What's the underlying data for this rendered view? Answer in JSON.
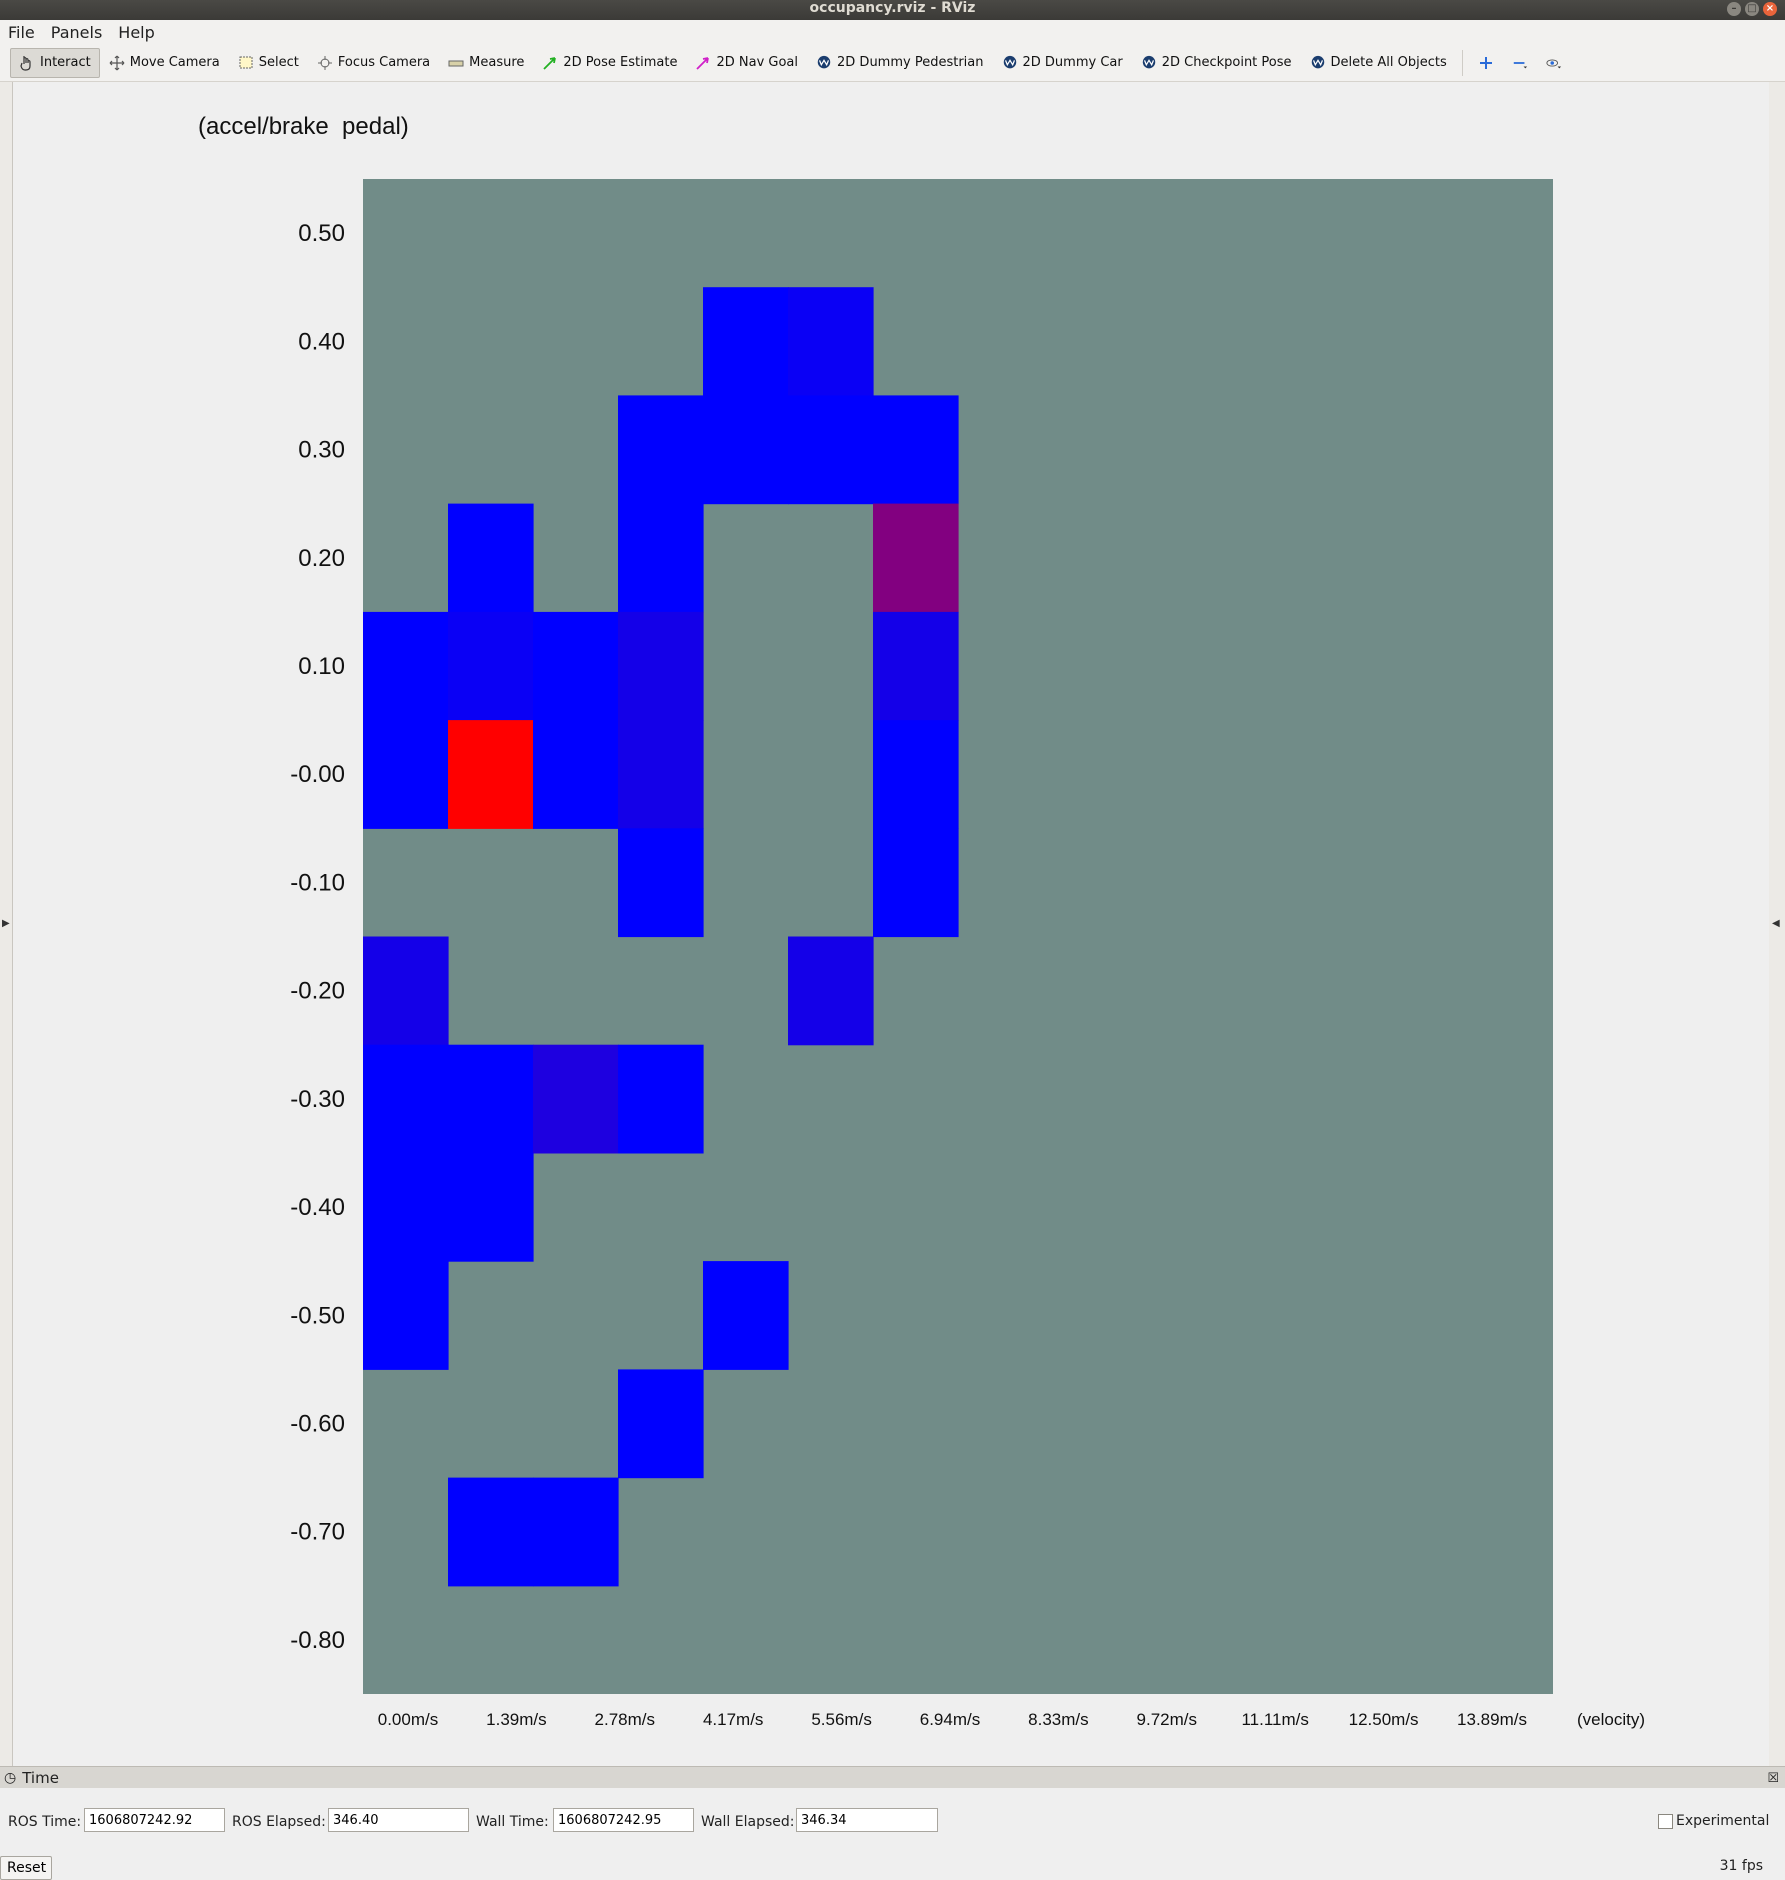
{
  "window": {
    "title": "occupancy.rviz - RViz"
  },
  "menu": {
    "items": [
      "File",
      "Panels",
      "Help"
    ]
  },
  "toolbar": {
    "tools": [
      {
        "label": "Interact",
        "icon": "hand-pointer-icon",
        "active": true
      },
      {
        "label": "Move Camera",
        "icon": "move-camera-icon",
        "active": false
      },
      {
        "label": "Select",
        "icon": "select-box-icon",
        "active": false
      },
      {
        "label": "Focus Camera",
        "icon": "focus-crosshair-icon",
        "active": false
      },
      {
        "label": "Measure",
        "icon": "ruler-icon",
        "active": false
      },
      {
        "label": "2D Pose Estimate",
        "icon": "green-arrow-icon",
        "active": false
      },
      {
        "label": "2D Nav Goal",
        "icon": "magenta-arrow-icon",
        "active": false
      },
      {
        "label": "2D Dummy Pedestrian",
        "icon": "autoware-logo-icon",
        "active": false
      },
      {
        "label": "2D Dummy Car",
        "icon": "autoware-logo-icon",
        "active": false
      },
      {
        "label": "2D Checkpoint Pose",
        "icon": "autoware-logo-icon",
        "active": false
      },
      {
        "label": "Delete All Objects",
        "icon": "autoware-logo-icon",
        "active": false
      }
    ],
    "extra_icons": [
      "add-tool-icon",
      "remove-tool-icon",
      "view-eye-icon"
    ]
  },
  "chart_data": {
    "type": "heatmap",
    "title": "",
    "ylabel": "(accel/brake  pedal)",
    "xlabel": "(velocity)",
    "x_ticks": [
      "0.00m/s",
      "1.39m/s",
      "2.78m/s",
      "4.17m/s",
      "5.56m/s",
      "6.94m/s",
      "8.33m/s",
      "9.72m/s",
      "11.11m/s",
      "12.50m/s",
      "13.89m/s"
    ],
    "y_ticks": [
      "0.50",
      "0.40",
      "0.30",
      "0.20",
      "0.10",
      "-0.00",
      "-0.10",
      "-0.20",
      "-0.30",
      "-0.40",
      "-0.50",
      "-0.60",
      "-0.70",
      "-0.80"
    ],
    "colors": {
      "background": "#718c88",
      "blue": "#0000ff",
      "blue_2": "#0a00f5",
      "blue_3": "#1400e8",
      "blue_4": "#1e00e0",
      "purple": "#820080",
      "red": "#ff0000"
    },
    "grid": [
      "..............",
      "....12........",
      "...1111.......",
      ".1.1..P.......",
      "1213..3.......",
      "1R13..1.......",
      "...1..1.......",
      "3....3........",
      "1141.........",
      "11............",
      "1...1.........",
      "...1..........",
      ".11...........",
      ".............."
    ],
    "grid_legend": {
      ".": "background",
      "1": "blue",
      "2": "blue_2",
      "3": "blue_3",
      "4": "blue_4",
      "P": "purple",
      "R": "red"
    }
  },
  "time_panel": {
    "title": "Time",
    "ros_time_label": "ROS Time:",
    "ros_time_value": "1606807242.92",
    "ros_elapsed_label": "ROS Elapsed:",
    "ros_elapsed_value": "346.40",
    "wall_time_label": "Wall Time:",
    "wall_time_value": "1606807242.95",
    "wall_elapsed_label": "Wall Elapsed:",
    "wall_elapsed_value": "346.34",
    "experimental_label": "Experimental",
    "experimental_checked": false,
    "reset_label": "Reset",
    "fps": "31 fps"
  }
}
